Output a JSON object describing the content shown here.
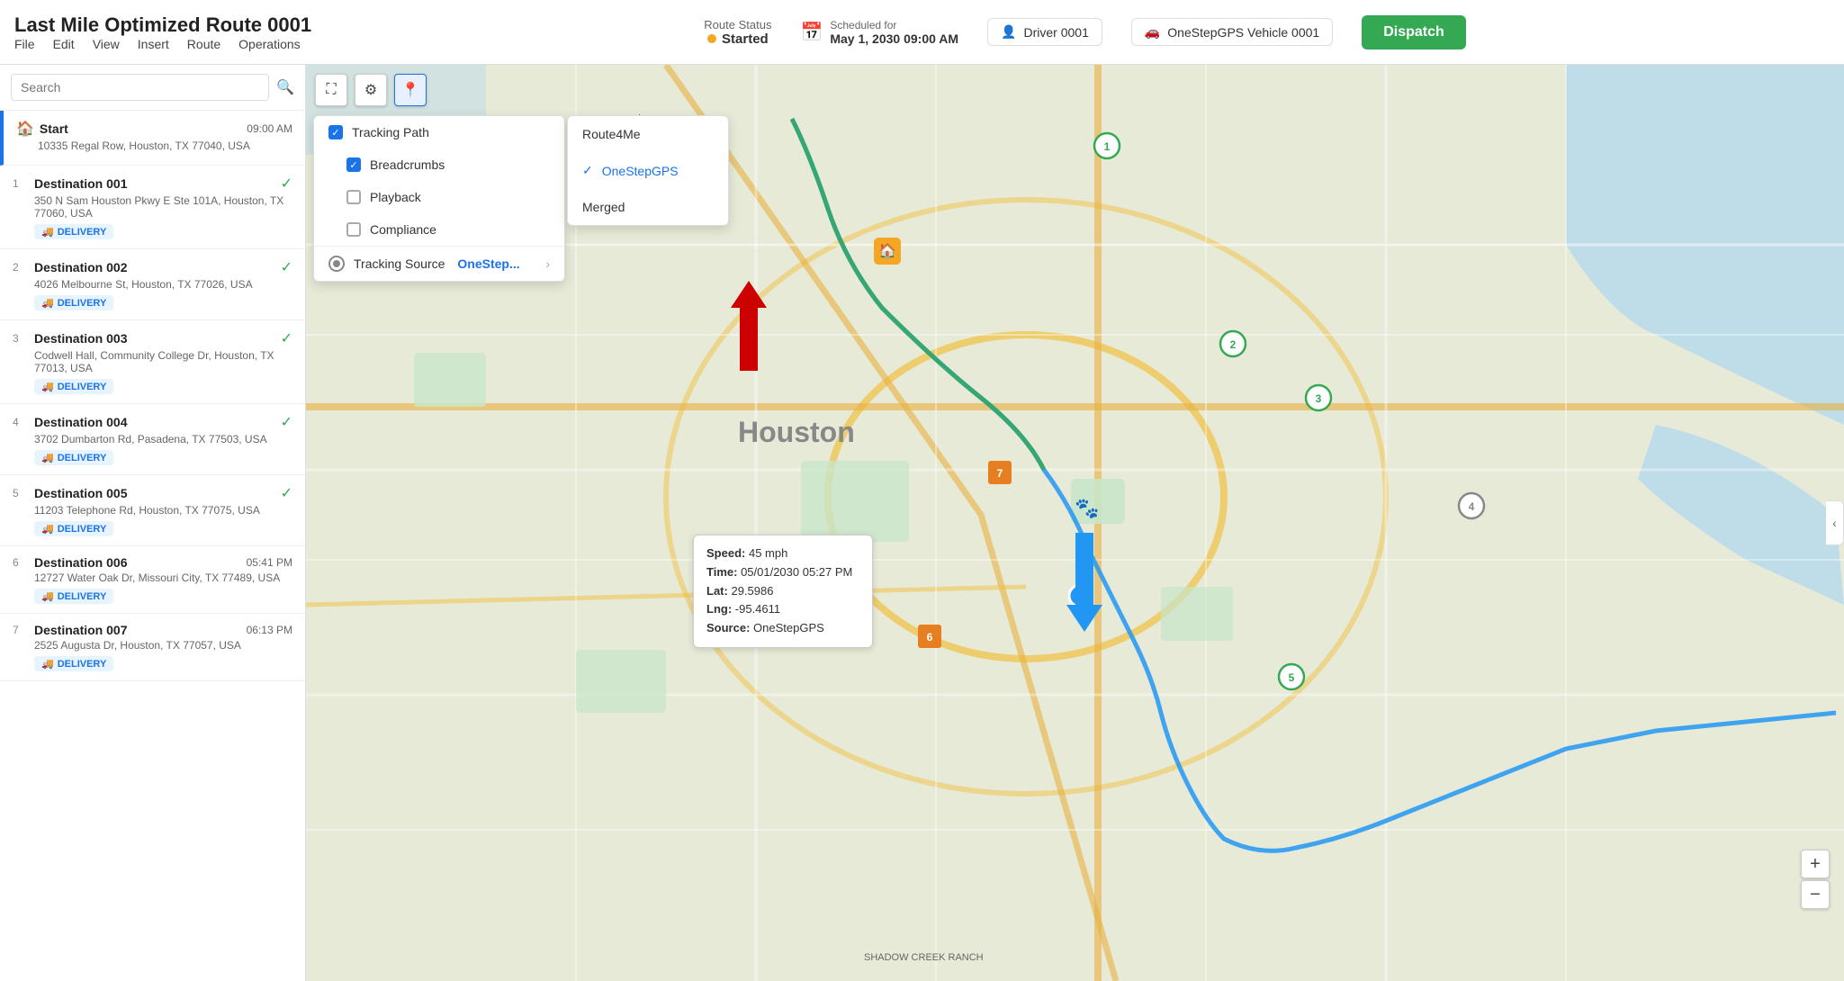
{
  "header": {
    "title": "Last Mile Optimized Route 0001",
    "menu": [
      "File",
      "Edit",
      "View",
      "Insert",
      "Route",
      "Operations"
    ],
    "route_status_label": "Route Status",
    "route_status_value": "Started",
    "scheduled_label": "Scheduled for",
    "scheduled_date": "May 1, 2030 09:00 AM",
    "driver_label": "Driver 0001",
    "vehicle_label": "OneStepGPS Vehicle 0001",
    "dispatch_label": "Dispatch"
  },
  "sidebar": {
    "search_placeholder": "Search",
    "stops": [
      {
        "number": "",
        "name": "Start",
        "address": "10335 Regal Row, Houston, TX 77040, USA",
        "time": "09:00 AM",
        "type": "start",
        "completed": false
      },
      {
        "number": "1",
        "name": "Destination 001",
        "address": "350 N Sam Houston Pkwy E Ste 101A, Houston, TX 77060, USA",
        "time": "",
        "type": "delivery",
        "completed": true
      },
      {
        "number": "2",
        "name": "Destination 002",
        "address": "4026 Melbourne St, Houston, TX 77026, USA",
        "time": "",
        "type": "delivery",
        "completed": true
      },
      {
        "number": "3",
        "name": "Destination 003",
        "address": "Codwell Hall, Community College Dr, Houston, TX 77013, USA",
        "time": "",
        "type": "delivery",
        "completed": true
      },
      {
        "number": "4",
        "name": "Destination 004",
        "address": "3702 Dumbarton Rd, Pasadena, TX 77503, USA",
        "time": "",
        "type": "delivery",
        "completed": true
      },
      {
        "number": "5",
        "name": "Destination 005",
        "address": "11203 Telephone Rd, Houston, TX 77075, USA",
        "time": "",
        "type": "delivery",
        "completed": true
      },
      {
        "number": "6",
        "name": "Destination 006",
        "address": "12727 Water Oak Dr, Missouri City, TX 77489, USA",
        "time": "05:41 PM",
        "type": "delivery",
        "completed": false
      },
      {
        "number": "7",
        "name": "Destination 007",
        "address": "2525 Augusta Dr, Houston, TX 77057, USA",
        "time": "06:13 PM",
        "type": "delivery",
        "completed": false
      }
    ],
    "delivery_badge": "DELIVERY"
  },
  "map": {
    "tracking_dropdown": {
      "tracking_path_label": "Tracking Path",
      "breadcrumbs_label": "Breadcrumbs",
      "playback_label": "Playback",
      "compliance_label": "Compliance",
      "tracking_source_label": "Tracking Source",
      "onestep_short": "OneStep...",
      "source_options": [
        "Route4Me",
        "OneStepGPS",
        "Merged"
      ],
      "selected_source": "OneStepGPS"
    },
    "tooltip": {
      "speed_label": "Speed:",
      "speed_value": "45 mph",
      "time_label": "Time:",
      "time_value": "05/01/2030 05:27 PM",
      "lat_label": "Lat:",
      "lat_value": "29.5986",
      "lng_label": "Lng:",
      "lng_value": "-95.4611",
      "source_label": "Source:",
      "source_value": "OneStepGPS"
    },
    "city_label": "Houston",
    "shadow_creek": "SHADOW CREEK RANCH"
  },
  "icons": {
    "search": "🔍",
    "home": "🏠",
    "truck": "🚚",
    "check": "✓",
    "calendar": "📅",
    "person": "👤",
    "car": "🚗",
    "expand": "⛶",
    "gear": "⚙",
    "location": "📍",
    "chevron_right": "›",
    "chevron_left": "‹",
    "paw": "🐾",
    "plus": "+",
    "minus": "−"
  }
}
